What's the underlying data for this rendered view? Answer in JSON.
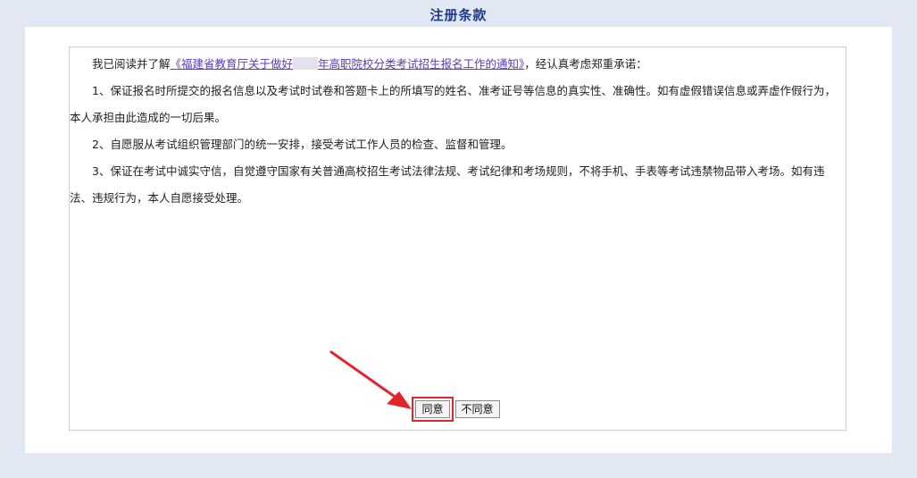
{
  "header": {
    "title": "注册条款"
  },
  "terms": {
    "intro_prefix": "我已阅读并了解",
    "notice_link_part1": "《福建省教育厅关于做好",
    "notice_link_part2": "年高职院校分类考试招生报名工作的通知》",
    "intro_suffix": "，经认真考虑郑重承诺：",
    "items": [
      "1、保证报名时所提交的报名信息以及考试时试卷和答题卡上的所填写的姓名、准考证号等信息的真实性、准确性。如有虚假错误信息或弄虚作假行为，本人承担由此造成的一切后果。",
      "2、自愿服从考试组织管理部门的统一安排，接受考试工作人员的检查、监督和管理。",
      "3、保证在考试中诚实守信，自觉遵守国家有关普通高校招生考试法律法规、考试纪律和考场规则，不将手机、手表等考试违禁物品带入考场。如有违法、违规行为，本人自愿接受处理。"
    ]
  },
  "buttons": {
    "agree_label": "同意",
    "disagree_label": "不同意"
  },
  "colors": {
    "annotation": "#e0262c",
    "link": "#5b3bb8",
    "title": "#1c3c8c"
  }
}
